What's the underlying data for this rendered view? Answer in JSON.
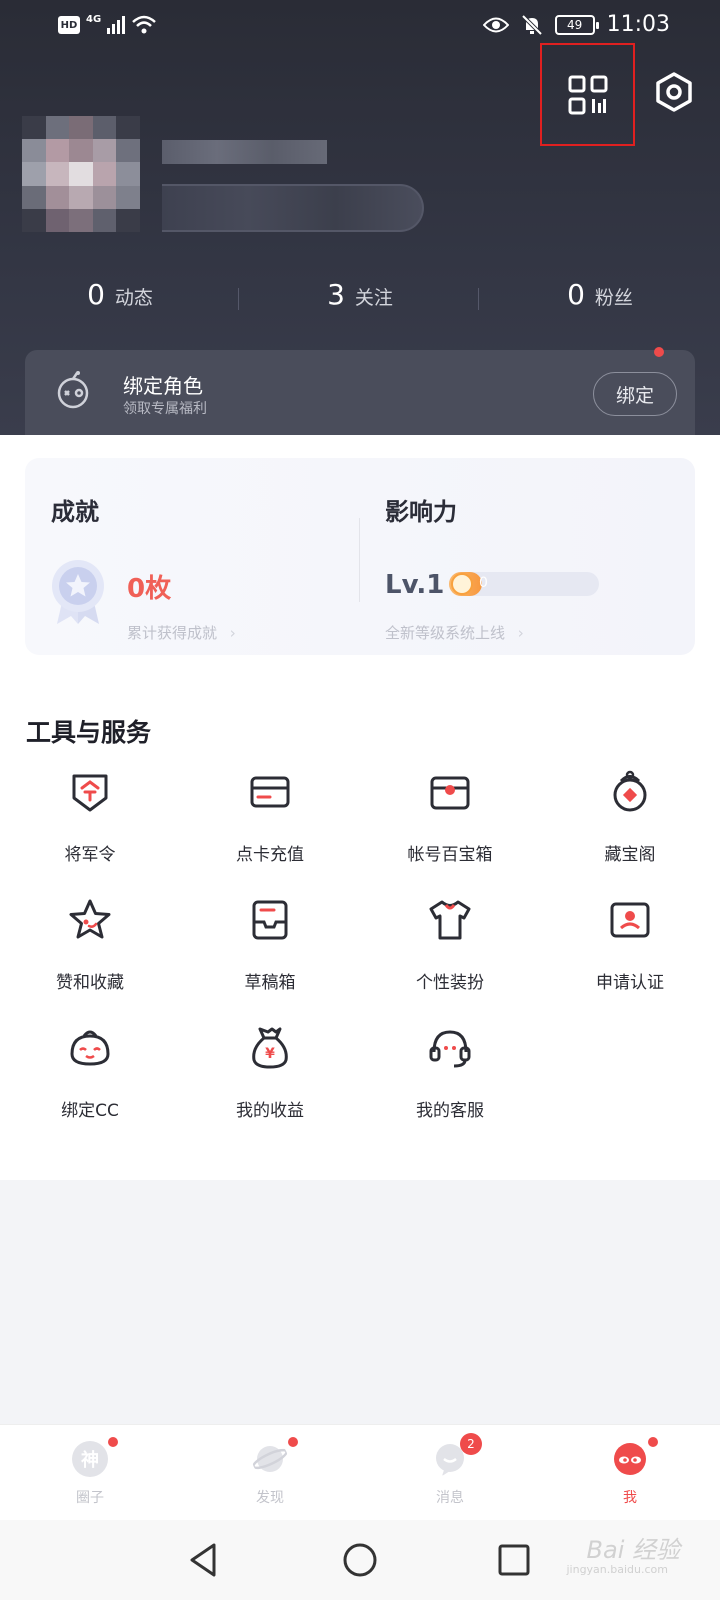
{
  "status_bar": {
    "hd": "HD",
    "network": "4G",
    "battery": "49",
    "time": "11:03"
  },
  "profile": {
    "stats": [
      {
        "num": "0",
        "label": "动态"
      },
      {
        "num": "3",
        "label": "关注"
      },
      {
        "num": "0",
        "label": "粉丝"
      }
    ]
  },
  "bind_card": {
    "title": "绑定角色",
    "subtitle": "领取专属福利",
    "button": "绑定"
  },
  "achievement": {
    "title": "成就",
    "count": "0枚",
    "hint": "累计获得成就"
  },
  "influence": {
    "title": "影响力",
    "level": "Lv.1",
    "points": "0",
    "progress": 0.22,
    "hint": "全新等级系统上线"
  },
  "tools": {
    "title": "工具与服务",
    "items": [
      {
        "label": "将军令",
        "icon": "general-order-icon"
      },
      {
        "label": "点卡充值",
        "icon": "card-recharge-icon"
      },
      {
        "label": "帐号百宝箱",
        "icon": "account-treasure-box-icon"
      },
      {
        "label": "藏宝阁",
        "icon": "treasure-pavilion-icon"
      },
      {
        "label": "赞和收藏",
        "icon": "star-favorite-icon"
      },
      {
        "label": "草稿箱",
        "icon": "draft-box-icon"
      },
      {
        "label": "个性装扮",
        "icon": "tshirt-icon"
      },
      {
        "label": "申请认证",
        "icon": "certification-icon"
      },
      {
        "label": "绑定CC",
        "icon": "cc-bind-icon"
      },
      {
        "label": "我的收益",
        "icon": "money-bag-icon"
      },
      {
        "label": "我的客服",
        "icon": "headset-icon"
      }
    ]
  },
  "bottom_nav": [
    {
      "label": "圈子",
      "badge": ""
    },
    {
      "label": "发现",
      "badge": ""
    },
    {
      "label": "消息",
      "badge": "2"
    },
    {
      "label": "我",
      "badge": ""
    }
  ],
  "colors": {
    "accent": "#ef4b4b",
    "header_bg": "#2e3039",
    "achievement_count": "#f06057"
  },
  "watermark": {
    "main": "Bai 经验",
    "sub": "jingyan.baidu.com"
  }
}
